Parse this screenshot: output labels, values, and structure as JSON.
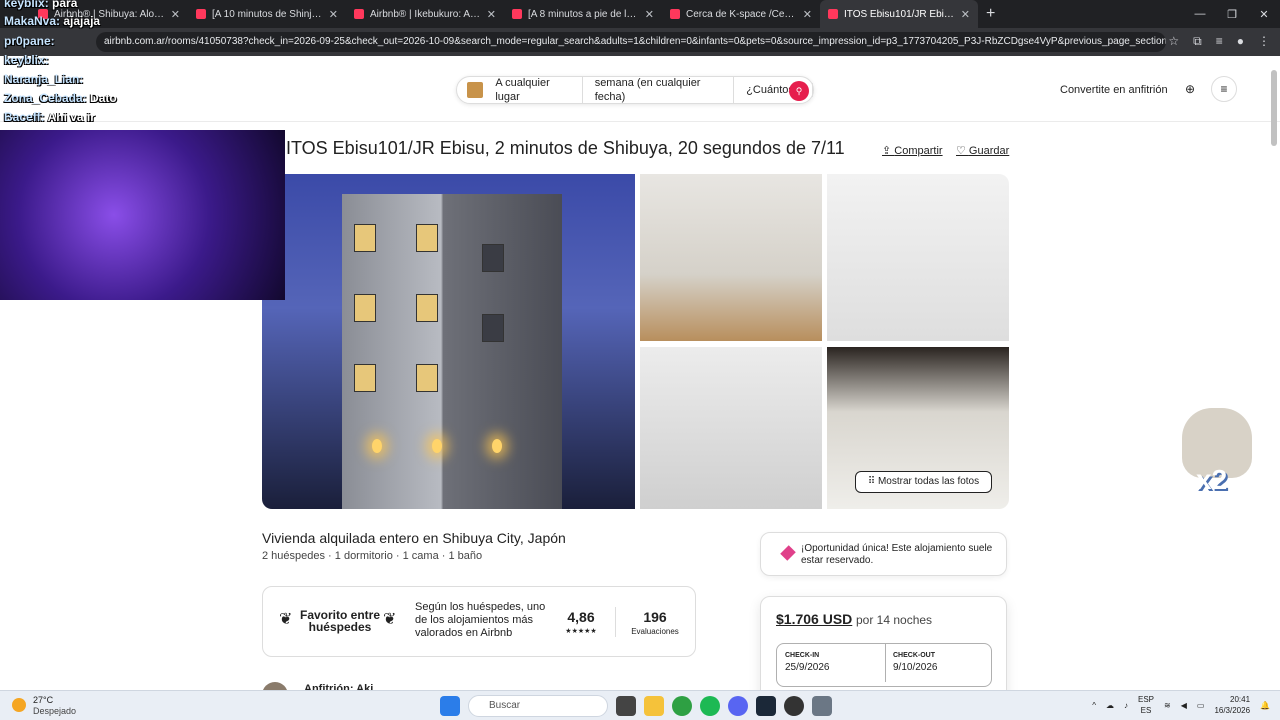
{
  "browser": {
    "tabs": [
      {
        "title": "Airbnb® | Shibuya: Alojamientos"
      },
      {
        "title": "[A 10 minutos de Shinjuku Stati"
      },
      {
        "title": "Airbnb® | Ikebukuro: Alojamien"
      },
      {
        "title": "[A 8 minutos a pie de la estació"
      },
      {
        "title": "Cerca de K-space /Cerca de Ebi"
      },
      {
        "title": "ITOS Ebisu101/JR Ebisu, 2 minu",
        "active": true
      }
    ],
    "url": "airbnb.com.ar/rooms/41050738?check_in=2026-09-25&check_out=2026-10-09&search_mode=regular_search&adults=1&children=0&infants=0&pets=0&source_impression_id=p3_1773704205_P3J-RbZCDgse4VyP&previous_page_section_name=1..."
  },
  "header": {
    "search": {
      "where": "A cualquier lugar",
      "when": "semana (en cualquier fecha)",
      "who": "¿Cuántos?"
    },
    "host_link": "Convertite en anfitrión"
  },
  "listing": {
    "title": "ITOS Ebisu101/JR Ebisu, 2 minutos de Shibuya, 20 segundos de 7/11",
    "share": "Compartir",
    "save": "Guardar",
    "show_photos": "Mostrar todas las fotos",
    "subtitle": "Vivienda alquilada entero en Shibuya City, Japón",
    "details": "2 huéspedes · 1 dormitorio · 1 cama · 1 baño",
    "favorite_label": "Favorito entre huéspedes",
    "favorite_desc": "Según los huéspedes, uno de los alojamientos más valorados en Airbnb",
    "rating": "4,86",
    "stars": "★★★★★",
    "reviews_count": "196",
    "reviews_label": "Evaluaciones",
    "host": "Anfitrión: Aki"
  },
  "booking": {
    "rare_text": "¡Oportunidad única! Este alojamiento suele estar reservado.",
    "price": "$1.706 USD",
    "per": "por 14 noches",
    "checkin_label": "CHECK-IN",
    "checkin": "25/9/2026",
    "checkout_label": "CHECK-OUT",
    "checkout": "9/10/2026"
  },
  "overlay": {
    "chat": [
      {
        "nick": "keyblix:",
        "msg": "para"
      },
      {
        "nick": "MakaNva:",
        "msg": "ajajaja"
      },
      {
        "nick": "pr0pane:",
        "msg": ""
      },
      {
        "nick": "keyblix:",
        "msg": ""
      },
      {
        "nick": "Naranja_Lian:",
        "msg": ""
      },
      {
        "nick": "Zona_Cebada:",
        "msg": "Dato"
      },
      {
        "nick": "Baceff:",
        "msg": "Ahi va ir"
      }
    ],
    "cat_badge": "x2"
  },
  "taskbar": {
    "temp": "27°C",
    "condition": "Despejado",
    "search": "Buscar",
    "lang1": "ESP",
    "lang2": "ES",
    "time": "20:41",
    "date": "16/3/2026"
  },
  "colors": {
    "brand": "#ff385c",
    "search_button": "#e61e4d"
  }
}
